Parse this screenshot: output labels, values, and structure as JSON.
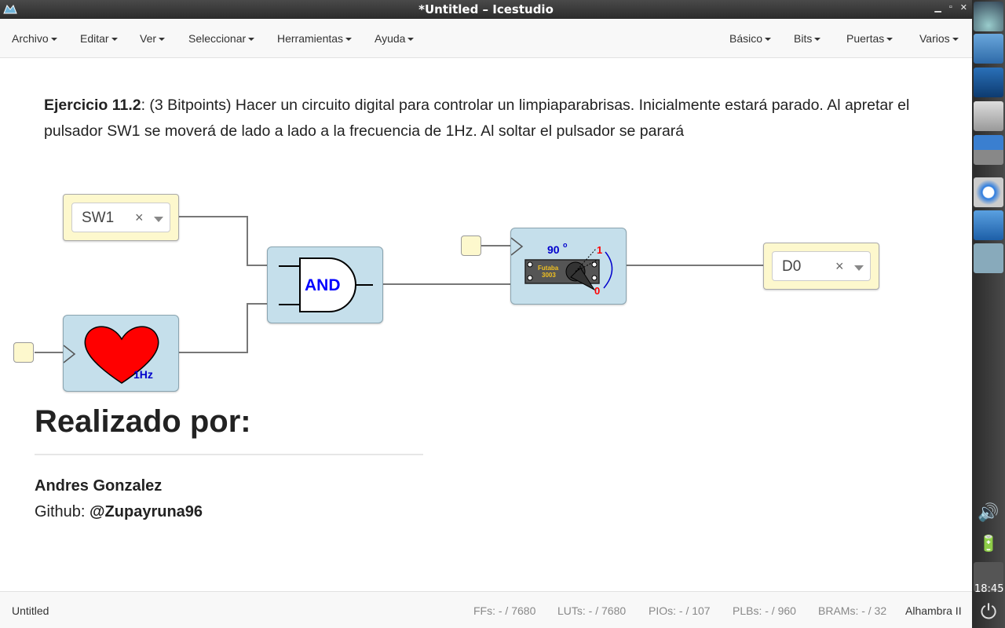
{
  "window": {
    "title": "*Untitled – Icestudio"
  },
  "menu": {
    "left": [
      "Archivo",
      "Editar",
      "Ver",
      "Seleccionar",
      "Herramientas",
      "Ayuda"
    ],
    "right": [
      "Básico",
      "Bits",
      "Puertas",
      "Varios"
    ]
  },
  "description": {
    "bold": "Ejercicio 11.2",
    "text": ": (3 Bitpoints) Hacer un circuito digital para controlar un limpiaparabrisas. Inicialmente estará parado. Al apretar el pulsador SW1 se moverá de lado a lado a la frecuencia de 1Hz. Al soltar el pulsador se parará"
  },
  "blocks": {
    "input_sw": {
      "value": "SW1",
      "clear": "×"
    },
    "heart_label": "1Hz",
    "and_label": "AND",
    "servo": {
      "angle": "90",
      "deg": "o",
      "one": "1",
      "zero": "0",
      "brand": "Futaba",
      "model": "3003"
    },
    "output_d": {
      "value": "D0",
      "clear": "×"
    }
  },
  "credits": {
    "heading": "Realizado por:",
    "author": "Andres Gonzalez",
    "github_prefix": "Github: ",
    "github_handle": "@Zupayruna96"
  },
  "status": {
    "file": "Untitled",
    "ffs": "FFs:  - / 7680",
    "luts": "LUTs:  - / 7680",
    "pios": "PIOs:  - / 107",
    "plbs": "PLBs:  - / 960",
    "brams": "BRAMs:  - / 32",
    "board": "Alhambra II"
  },
  "clock": "18:45",
  "colors": {
    "wire": "#777777",
    "block_blue": "#c5dfeb",
    "io_yellow": "#fdf8cd",
    "heart": "#ff0000",
    "and_text": "#0000ff"
  }
}
